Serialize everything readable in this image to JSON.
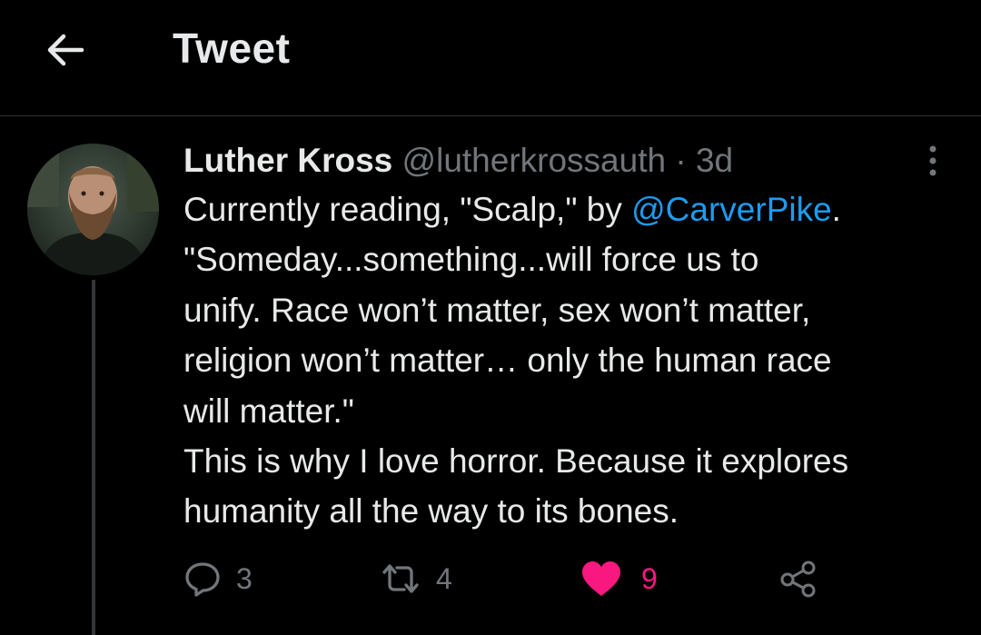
{
  "header": {
    "title": "Tweet",
    "back_icon": "arrow-left-icon"
  },
  "tweet": {
    "author_name": "Luther Kross",
    "handle": "@lutherkrossauth",
    "separator": "·",
    "time": "3d",
    "text_lines": [
      [
        "Currently reading, \"Scalp,\" by ",
        "@CarverPike",
        "."
      ],
      "\"Someday...something...will force us to",
      "unify. Race won’t matter, sex won’t matter,",
      "religion won’t matter… only the human race",
      "will matter.\"",
      "This is why I love horror. Because it explores",
      "humanity all the way to its bones."
    ],
    "mention": "@CarverPike"
  },
  "actions": {
    "reply_count": "3",
    "retweet_count": "4",
    "like_count": "9",
    "icons": [
      "reply-icon",
      "retweet-icon",
      "heart-icon",
      "share-icon"
    ]
  },
  "colors": {
    "background": "#000000",
    "text": "#e7e9ea",
    "muted": "#71767b",
    "link": "#1d9bf0",
    "like": "#f91880",
    "divider": "#2f3336"
  }
}
